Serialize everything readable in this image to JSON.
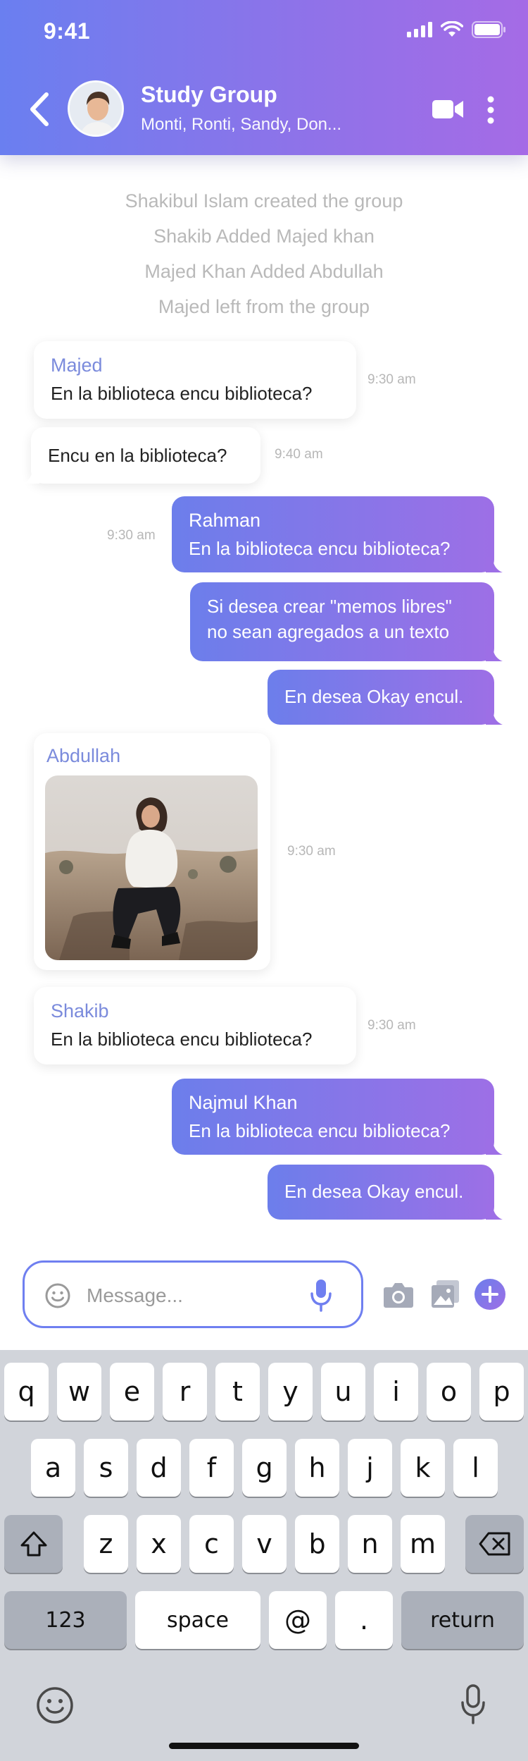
{
  "status": {
    "time": "9:41"
  },
  "header": {
    "title": "Study Group",
    "subtitle": "Monti, Ronti, Sandy, Don..."
  },
  "system_messages": [
    "Shakibul Islam created the group",
    "Shakib Added Majed khan",
    "Majed Khan Added Abdullah",
    "Majed left from the group"
  ],
  "messages": [
    {
      "sender": "Majed",
      "text": "En la biblioteca encu biblioteca?",
      "time": "9:30 am"
    },
    {
      "text": "Encu en la biblioteca?",
      "time": "9:40 am"
    },
    {
      "sender": "Rahman",
      "text": "En la biblioteca encu biblioteca?",
      "time": "9:30 am"
    },
    {
      "line1": "Si desea crear \"memos libres\"",
      "line2": "no sean agregados a un texto"
    },
    {
      "text": "En desea Okay encul."
    },
    {
      "sender": "Abdullah",
      "time": "9:30 am"
    },
    {
      "sender": "Shakib",
      "text": "En la biblioteca encu biblioteca?",
      "time": "9:30 am"
    },
    {
      "sender": "Najmul Khan",
      "text": "En la biblioteca encu biblioteca?"
    },
    {
      "text": "En desea Okay encul."
    }
  ],
  "composer": {
    "placeholder": "Message..."
  },
  "keyboard": {
    "row1": [
      "q",
      "w",
      "e",
      "r",
      "t",
      "y",
      "u",
      "i",
      "o",
      "p"
    ],
    "row2": [
      "a",
      "s",
      "d",
      "f",
      "g",
      "h",
      "j",
      "k",
      "l"
    ],
    "row3": [
      "z",
      "x",
      "c",
      "v",
      "b",
      "n",
      "m"
    ],
    "numbers": "123",
    "space": "space",
    "at": "@",
    "period": ".",
    "return": "return"
  },
  "colors": {
    "accent_start": "#6c7eeb",
    "accent_end": "#9d6fe6",
    "sender_name": "#7b8bdc"
  }
}
